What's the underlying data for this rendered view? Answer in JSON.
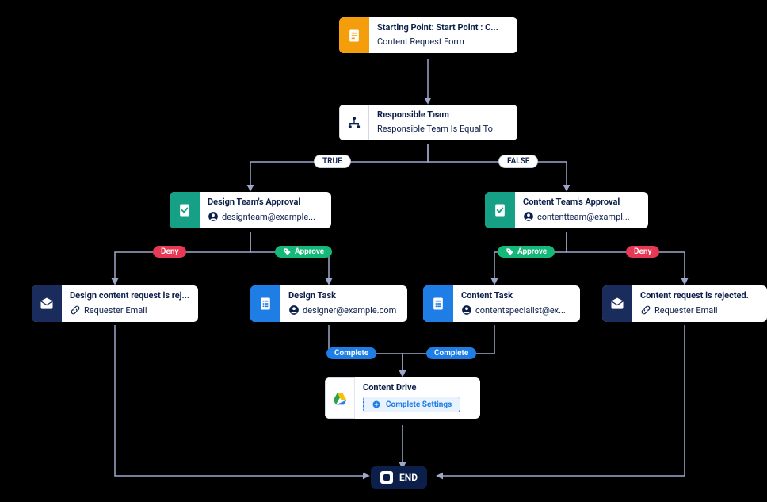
{
  "nodes": {
    "start": {
      "title": "Starting Point: Start Point : C...",
      "subtitle": "Content Request Form"
    },
    "condition": {
      "title": "Responsible Team",
      "subtitle": "Responsible Team Is Equal To"
    },
    "designApproval": {
      "title": "Design Team's Approval",
      "subtitle": "designteam@example..."
    },
    "contentApproval": {
      "title": "Content Team's Approval",
      "subtitle": "contentteam@exampl..."
    },
    "designRejected": {
      "title": "Design content request is rej...",
      "subtitle": "Requester Email"
    },
    "designTask": {
      "title": "Design Task",
      "subtitle": "designer@example.com"
    },
    "contentTask": {
      "title": "Content Task",
      "subtitle": "contentspecialist@ex..."
    },
    "contentRejected": {
      "title": "Content request is rejected.",
      "subtitle": "Requester Email"
    },
    "drive": {
      "title": "Content Drive",
      "cta": "Complete Settings"
    },
    "end": {
      "label": "END"
    }
  },
  "edges": {
    "true": "TRUE",
    "false": "FALSE",
    "deny": "Deny",
    "approve": "Approve",
    "complete": "Complete"
  },
  "colors": {
    "orange": "#f59e0b",
    "green": "#16a085",
    "blue": "#1f7de6",
    "navy": "#1a2c5b",
    "pillDeny": "#e53955",
    "pillApprove": "#16b87a"
  }
}
